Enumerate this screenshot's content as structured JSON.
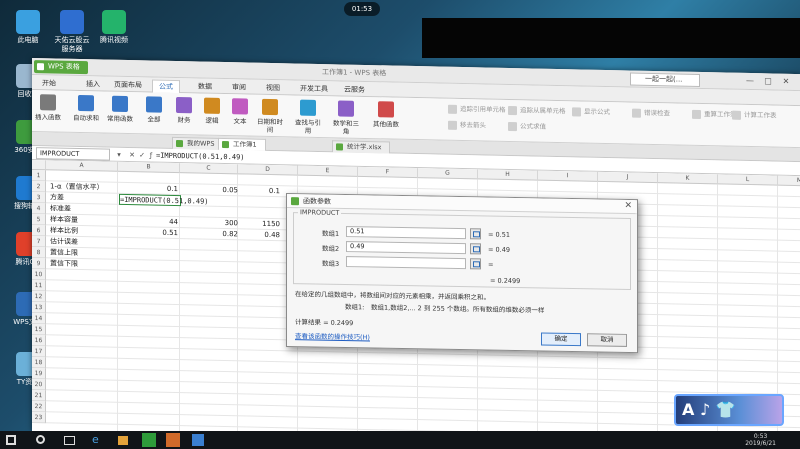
{
  "screen": {
    "clock_pill": "01:53"
  },
  "desktop": {
    "icons": [
      {
        "label": "此电脑",
        "color": "#3aa0e0"
      },
      {
        "label": "天佑云股云\n服务器",
        "color": "#2f6ed0"
      },
      {
        "label": "腾讯视频",
        "color": "#24b36b"
      },
      {
        "label": "回收站",
        "color": "#9ab7cf"
      },
      {
        "label": "360安全",
        "color": "#3e9b3e"
      },
      {
        "label": "搜狗输入",
        "color": "#1f7ad0"
      },
      {
        "label": "腾讯QQ",
        "color": "#e0402a"
      },
      {
        "label": "WPS文字",
        "color": "#2d6bb5"
      },
      {
        "label": "TY资料",
        "color": "#6bb0d8"
      }
    ]
  },
  "window": {
    "app_badge": "WPS 表格",
    "doc_title": "工作簿1 - WPS 表格",
    "user": "一起一起(...",
    "controls": [
      "—",
      "□",
      "✕"
    ],
    "menu": [
      {
        "label": "开始",
        "active": false
      },
      {
        "label": "插入",
        "active": false
      },
      {
        "label": "页面布局",
        "active": false
      },
      {
        "label": "公式",
        "active": true
      },
      {
        "label": "数据",
        "active": false
      },
      {
        "label": "审阅",
        "active": false
      },
      {
        "label": "视图",
        "active": false
      },
      {
        "label": "开发工具",
        "active": false
      },
      {
        "label": "云服务",
        "active": false
      }
    ],
    "ribbon": [
      {
        "label": "插入函数",
        "icon": "fx-icon",
        "color": "#7a7a7a"
      },
      {
        "label": "自动求和",
        "icon": "sum-icon",
        "color": "#3a78c8"
      },
      {
        "label": "常用函数",
        "icon": "star-icon",
        "color": "#3a78c8"
      },
      {
        "label": "全部",
        "icon": "list-icon",
        "color": "#3a78c8"
      },
      {
        "label": "财务",
        "icon": "finance-icon",
        "color": "#8b5fc7"
      },
      {
        "label": "逻辑",
        "icon": "logic-icon",
        "color": "#d08a20"
      },
      {
        "label": "文本",
        "icon": "text-icon",
        "color": "#c05bc0"
      },
      {
        "label": "日期和时间",
        "icon": "clock-icon",
        "color": "#d08a20"
      },
      {
        "label": "查找与引用",
        "icon": "lookup-icon",
        "color": "#2d9bd0"
      },
      {
        "label": "数学和三角",
        "icon": "math-icon",
        "color": "#8b5fc7"
      },
      {
        "label": "其他函数",
        "icon": "more-icon",
        "color": "#d04a4a"
      }
    ],
    "ribbon_right": [
      "追踪引用单元格",
      "追踪从属单元格",
      "显示公式",
      "错误检查",
      "移去箭头",
      "公式求值",
      "重算工作簿",
      "计算工作表"
    ],
    "file_tabs": [
      {
        "label": "我的WPS",
        "active": false
      },
      {
        "label": "工作簿1",
        "active": true
      },
      {
        "label": "统计学.xlsx",
        "active": false
      }
    ],
    "formula_bar": {
      "name_box": "IMPRODUCT",
      "formula": "=IMPRODUCT(0.51,0.49)"
    }
  },
  "sheet": {
    "columns": [
      "A",
      "B",
      "C",
      "D",
      "E",
      "F",
      "G",
      "H",
      "I",
      "J",
      "K",
      "L",
      "M"
    ],
    "rows": [
      "1",
      "2",
      "3",
      "4",
      "5",
      "6",
      "7",
      "8",
      "9",
      "10",
      "11",
      "12",
      "13",
      "14",
      "15",
      "16",
      "17",
      "18",
      "19",
      "20",
      "21",
      "22",
      "23"
    ],
    "cells": {
      "a2": "1-α（置信水平）",
      "a3": "方差",
      "a4": "标准差",
      "a5": "样本容量",
      "a6": "样本比例",
      "a7": "估计误差",
      "a8": "置信上限",
      "a9": "置信下限",
      "b2": "0.1",
      "c2": "0.05",
      "d2": "0.1",
      "b3": "=IMPRODUCT(0.51,0.49)",
      "b5": "44",
      "c5": "300",
      "d5": "1150",
      "b6": "0.51",
      "c6": "0.82",
      "d6": "0.48"
    }
  },
  "dialog": {
    "title": "函数参数",
    "group_label": "IMPRODUCT",
    "args": [
      {
        "label": "数组1",
        "value": "0.51",
        "result": "= 0.51"
      },
      {
        "label": "数组2",
        "value": "0.49",
        "result": "= 0.49"
      },
      {
        "label": "数组3",
        "value": "",
        "result": "="
      }
    ],
    "total": "= 0.2499",
    "desc1": "在给定的几组数组中，将数组间对应的元素相乘，并返回乘积之和。",
    "desc2_label": "数组1:",
    "desc2": "数组1,数组2,... 2 到 255 个数组。所有数组的维数必须一样",
    "calc_label": "计算结果 = 0.2499",
    "help_link": "查看该函数的操作技巧(H)",
    "ok": "确定",
    "cancel": "取消"
  },
  "sticker": {
    "text": "A ♪ 👕"
  },
  "taskbar": {
    "clock_time": "0:53",
    "clock_date": "2019/6/21"
  }
}
